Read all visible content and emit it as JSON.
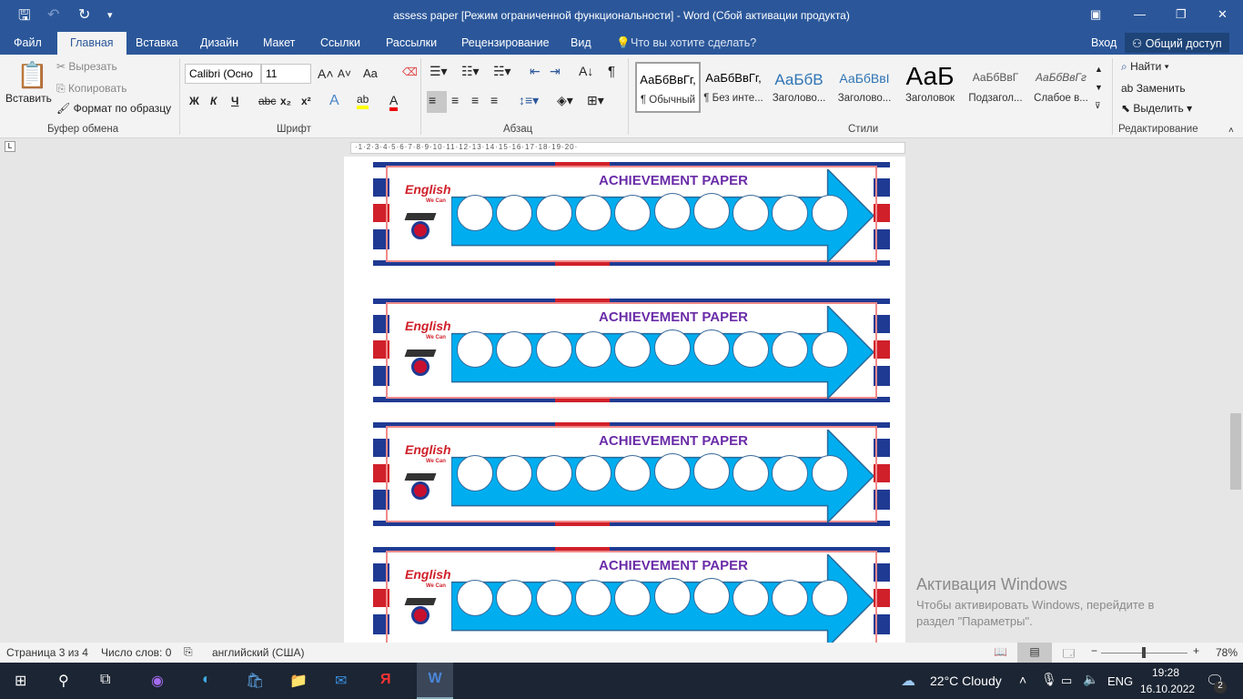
{
  "titlebar": {
    "title": "assess paper [Режим ограниченной функциональности] - Word (Сбой активации продукта)"
  },
  "tabs": [
    "Файл",
    "Главная",
    "Вставка",
    "Дизайн",
    "Макет",
    "Ссылки",
    "Рассылки",
    "Рецензирование",
    "Вид"
  ],
  "tell_me": "Что вы хотите сделать?",
  "signin": "Вход",
  "share": "Общий доступ",
  "clipboard": {
    "paste": "Вставить",
    "cut": "Вырезать",
    "copy": "Копировать",
    "format": "Формат по образцу",
    "group": "Буфер обмена"
  },
  "font": {
    "name": "Calibri (Осно",
    "size": "11",
    "group": "Шрифт",
    "bold": "Ж",
    "italic": "К",
    "underline": "Ч",
    "strike": "abc",
    "sub": "x₂",
    "sup": "x²",
    "case": "Aa"
  },
  "paragraph": {
    "group": "Абзац"
  },
  "styles": {
    "group": "Стили",
    "items": [
      {
        "preview": "АаБбВвГг,",
        "name": "¶ Обычный"
      },
      {
        "preview": "АаБбВвГг,",
        "name": "¶ Без инте..."
      },
      {
        "preview": "АаБбВ",
        "name": "Заголово..."
      },
      {
        "preview": "АаБбВвІ",
        "name": "Заголово..."
      },
      {
        "preview": "АаБ",
        "name": "Заголовок"
      },
      {
        "preview": "АаБбВвГ",
        "name": "Подзагол..."
      },
      {
        "preview": "АаБбВвГг",
        "name": "Слабое в..."
      }
    ]
  },
  "editing": {
    "group": "Редактирование",
    "find": "Найти",
    "replace": "Заменить",
    "select": "Выделить"
  },
  "banner": {
    "title": "ACHIEVEMENT PAPER",
    "logo": "English",
    "logo_sub": "We Can",
    "circles": 10,
    "count": 4
  },
  "activation": {
    "title": "Активация Windows",
    "line1": "Чтобы активировать Windows, перейдите в",
    "line2": "раздел \"Параметры\"."
  },
  "status": {
    "page": "Страница 3 из 4",
    "words": "Число слов: 0",
    "lang": "английский (США)",
    "zoom": "78%",
    "zoom_fraction": 0.47
  },
  "taskbar": {
    "weather": "22°C  Cloudy",
    "lang": "ENG",
    "time": "19:28",
    "date": "16.10.2022",
    "notifications": "2"
  },
  "colors": {
    "accent": "#2b579a",
    "arrow": "#00aeef",
    "title": "#6a2ca8"
  }
}
